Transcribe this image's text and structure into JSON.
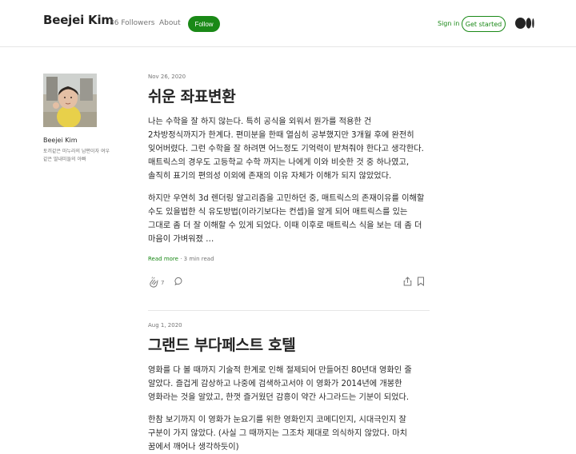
{
  "header": {
    "brand": "Beejei Kim",
    "followers": "86 Followers",
    "about": "About",
    "follow": "Follow",
    "sign_in": "Sign in",
    "get_started": "Get started",
    "accent": "#1a8917"
  },
  "sidebar": {
    "name": "Beejei Kim",
    "bio_line1": "토끼같은 마누라의 남편이자 여우",
    "bio_line2": "같은 딸내미들의 아빠"
  },
  "posts": [
    {
      "date": "Nov 26, 2020",
      "title": "쉬운 좌표변환",
      "para1": "나는 수학을 잘 하지 않는다. 특히 공식을 외워서 뭔가를 적용한 건 2차방정식까지가 한계다. 편미분을 한때 열심히 공부했지만 3개월 후에 완전히 잊어버렸다. 그런 수학을 잘 하려면 어느정도 기억력이 받쳐줘야 한다고 생각한다. 매트릭스의 경우도 고등학교 수학 까지는 나에게 이와 비슷한 것 중 하나였고, 솔직히 표기의 편의성 이외에 존재의 이유 자체가 이해가 되지 않았었다.",
      "para2": "하지만 우연히 3d 렌더링 알고리즘을 고민하던 중, 매트릭스의 존재이유를 이해할 수도 있을법한 식 유도방법(이라기보다는 컨셉)을 알게 되어 매트릭스를 있는 그대로 좀 더 잘 이해할 수 있게 되었다. 이때 이후로 매트릭스 식을 보는 데 좀 더 마음이 가벼워졌 …",
      "read_more": "Read more",
      "separator": "·",
      "read_time": "3 min read",
      "claps": "7"
    },
    {
      "date": "Aug 1, 2020",
      "title": "그랜드 부다페스트 호텔",
      "para1": "영화를 다 볼 때까지 기술적 한계로 인해 절제되어 만들어진 80년대 영화인 줄 알았다. 즐겁게 감상하고 나중에 검색하고서야 이 영화가 2014년에 개봉한 영화라는 것을 알았고, 한껏 즐거웠던 감흥이 약간 사그라드는 기분이 되었다.",
      "para2": "한참 보기까지 이 영화가 눈요기를 위한 영화인지 코메디인지, 시대극인지 잘 구분이 가지 않았다. (사실 그 때까지는 그조차 제대로 의식하지 않았다. 마치 꿈에서 깨어나 생각하듯이)"
    }
  ],
  "icons": [
    "medium-logo-icon",
    "clap-icon",
    "comment-icon",
    "share-icon",
    "bookmark-icon"
  ]
}
